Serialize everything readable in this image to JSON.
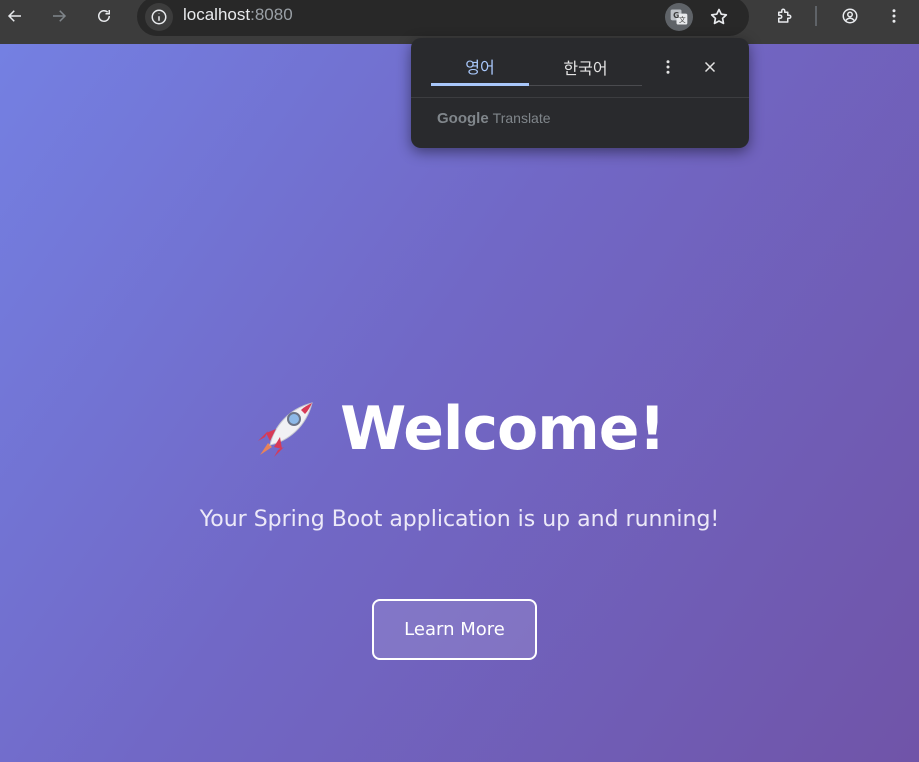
{
  "browser": {
    "url_host": "localhost",
    "url_port": ":8080",
    "icons": {
      "back": "arrow-left-icon",
      "forward": "arrow-right-icon",
      "reload": "reload-icon",
      "site_info": "info-icon",
      "translate": "translate-icon",
      "bookmark": "star-icon",
      "extensions": "puzzle-icon",
      "profile": "account-icon",
      "menu": "kebab-menu-icon"
    }
  },
  "translate_popup": {
    "tabs": [
      {
        "label": "영어",
        "active": true
      },
      {
        "label": "한국어",
        "active": false
      }
    ],
    "footer_brand": "Google",
    "footer_label": "Translate",
    "icons": {
      "menu": "kebab-menu-icon",
      "close": "close-icon"
    }
  },
  "page": {
    "title": "Welcome!",
    "subtitle": "Your Spring Boot application is up and running!",
    "button_label": "Learn More",
    "hero_icon": "rocket-icon",
    "colors": {
      "gradient_start": "#7480e2",
      "gradient_end": "#7054a8",
      "text": "#ffffff"
    }
  }
}
